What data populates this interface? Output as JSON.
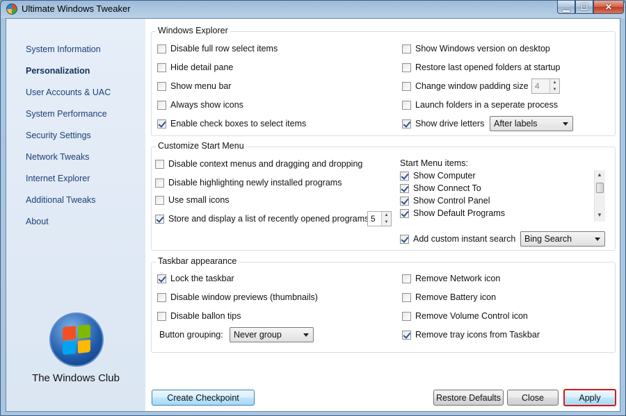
{
  "window": {
    "title": "Ultimate Windows Tweaker",
    "minimize": "▁",
    "maximize": "☐",
    "close": "✕"
  },
  "sidebar": {
    "items": [
      {
        "label": "System Information"
      },
      {
        "label": "Personalization"
      },
      {
        "label": "User Accounts & UAC"
      },
      {
        "label": "System Performance"
      },
      {
        "label": "Security Settings"
      },
      {
        "label": "Network Tweaks"
      },
      {
        "label": "Internet Explorer"
      },
      {
        "label": "Additional Tweaks"
      },
      {
        "label": "About"
      }
    ],
    "active": "Personalization",
    "logo_text": "The Windows Club"
  },
  "explorer": {
    "title": "Windows Explorer",
    "left": [
      {
        "label": "Disable full row select items",
        "checked": false
      },
      {
        "label": "Hide detail pane",
        "checked": false
      },
      {
        "label": "Show menu bar",
        "checked": false
      },
      {
        "label": "Always show icons",
        "checked": false
      },
      {
        "label": "Enable check boxes to select items",
        "checked": true
      }
    ],
    "right": [
      {
        "label": "Show Windows version on desktop",
        "checked": false
      },
      {
        "label": "Restore last opened folders at startup",
        "checked": false
      },
      {
        "label": "Change window padding size",
        "checked": false
      },
      {
        "label": "Launch folders in a seperate process",
        "checked": false
      },
      {
        "label": "Show drive letters",
        "checked": true
      }
    ],
    "padding_value": "4",
    "drive_letters_option": "After labels"
  },
  "start_menu": {
    "title": "Customize Start Menu",
    "left": [
      {
        "label": "Disable context menus and dragging and dropping",
        "checked": false
      },
      {
        "label": "Disable highlighting newly installed programs",
        "checked": false
      },
      {
        "label": "Use small icons",
        "checked": false
      },
      {
        "label": "Store and display a list of recently opened programs",
        "checked": true
      }
    ],
    "recent_count": "5",
    "items_label": "Start Menu items:",
    "items": [
      {
        "label": "Show Computer",
        "checked": true
      },
      {
        "label": "Show Connect To",
        "checked": true
      },
      {
        "label": "Show Control Panel",
        "checked": true
      },
      {
        "label": "Show Default Programs",
        "checked": true
      }
    ],
    "custom_search": {
      "label": "Add custom instant search",
      "checked": true
    },
    "search_option": "Bing Search"
  },
  "taskbar": {
    "title": "Taskbar appearance",
    "left": [
      {
        "label": "Lock the taskbar",
        "checked": true
      },
      {
        "label": "Disable window previews (thumbnails)",
        "checked": false
      },
      {
        "label": "Disable ballon tips",
        "checked": false
      }
    ],
    "right": [
      {
        "label": "Remove Network icon",
        "checked": false
      },
      {
        "label": "Remove Battery icon",
        "checked": false
      },
      {
        "label": "Remove Volume Control icon",
        "checked": false
      },
      {
        "label": "Remove tray icons from Taskbar",
        "checked": true
      }
    ],
    "grouping_label": "Button grouping:",
    "grouping_option": "Never group"
  },
  "buttons": {
    "checkpoint": "Create Checkpoint",
    "restore": "Restore Defaults",
    "close": "Close",
    "apply": "Apply"
  },
  "colors": {
    "sidebar_text": "#1c3f78",
    "apply_outline": "#d21919",
    "accent": "#3c7fb1"
  }
}
